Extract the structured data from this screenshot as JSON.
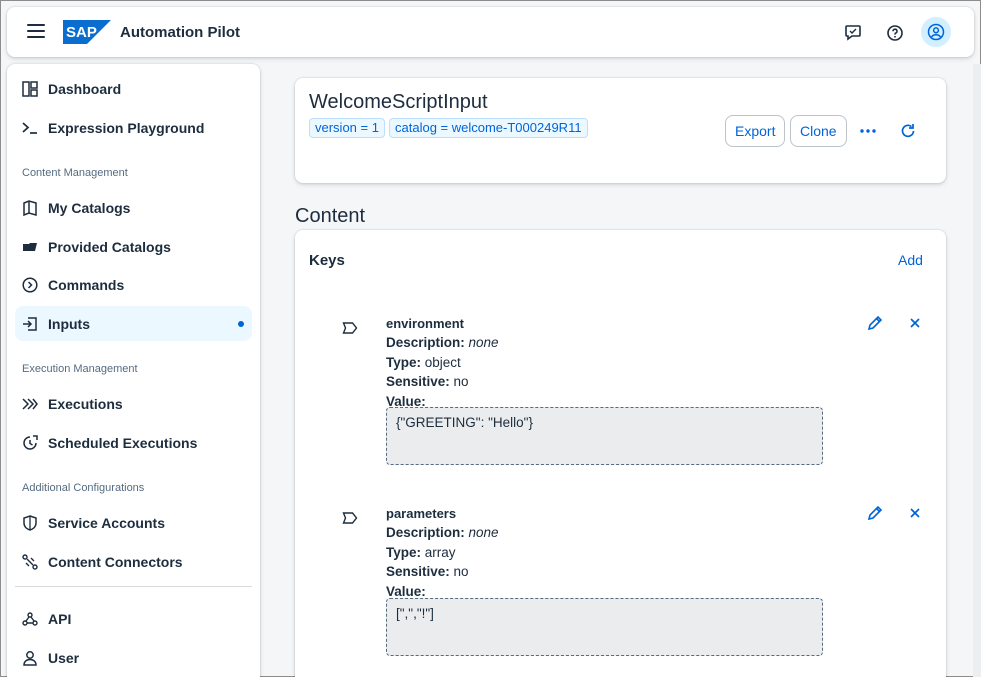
{
  "shell": {
    "brand_logo": "SAP",
    "app_title": "Automation Pilot",
    "icons": [
      "menu-icon",
      "feedback-icon",
      "help-icon",
      "user-avatar-icon"
    ]
  },
  "sidenav": {
    "items": [
      {
        "label": "Dashboard",
        "icon": "dashboard-icon"
      },
      {
        "label": "Expression Playground",
        "icon": "terminal-icon"
      },
      {
        "label": "My Catalogs",
        "icon": "catalog-icon"
      },
      {
        "label": "Provided Catalogs",
        "icon": "folder-icon"
      },
      {
        "label": "Commands",
        "icon": "command-icon"
      },
      {
        "label": "Inputs",
        "icon": "input-icon"
      },
      {
        "label": "Executions",
        "icon": "executions-icon"
      },
      {
        "label": "Scheduled Executions",
        "icon": "scheduled-icon"
      },
      {
        "label": "Service Accounts",
        "icon": "shield-icon"
      },
      {
        "label": "Content Connectors",
        "icon": "connector-icon"
      },
      {
        "label": "API",
        "icon": "api-icon"
      },
      {
        "label": "User",
        "icon": "user-icon"
      }
    ],
    "groups": {
      "content": "Content Management",
      "execution": "Execution Management",
      "additional": "Additional Configurations"
    },
    "selected": "Inputs"
  },
  "header": {
    "title": "WelcomeScriptInput",
    "tokens": [
      "version = 1",
      "catalog = welcome-T000249R11"
    ],
    "export_label": "Export",
    "clone_label": "Clone"
  },
  "content": {
    "section_title": "Content",
    "keys_title": "Keys",
    "add_label": "Add",
    "labels": {
      "description": "Description:",
      "type": "Type:",
      "sensitive": "Sensitive:",
      "value": "Value:"
    },
    "keys": [
      {
        "name": "environment",
        "description": "none",
        "type": "object",
        "sensitive": "no",
        "value": "{\"GREETING\": \"Hello\"}"
      },
      {
        "name": "parameters",
        "description": "none",
        "type": "array",
        "sensitive": "no",
        "value": "[\",\",\"!\"]"
      }
    ]
  },
  "colors": {
    "accent": "#0064d9",
    "selected_bg": "#ebf8ff",
    "text": "#1d2d3e",
    "background": "#f5f6f7"
  }
}
